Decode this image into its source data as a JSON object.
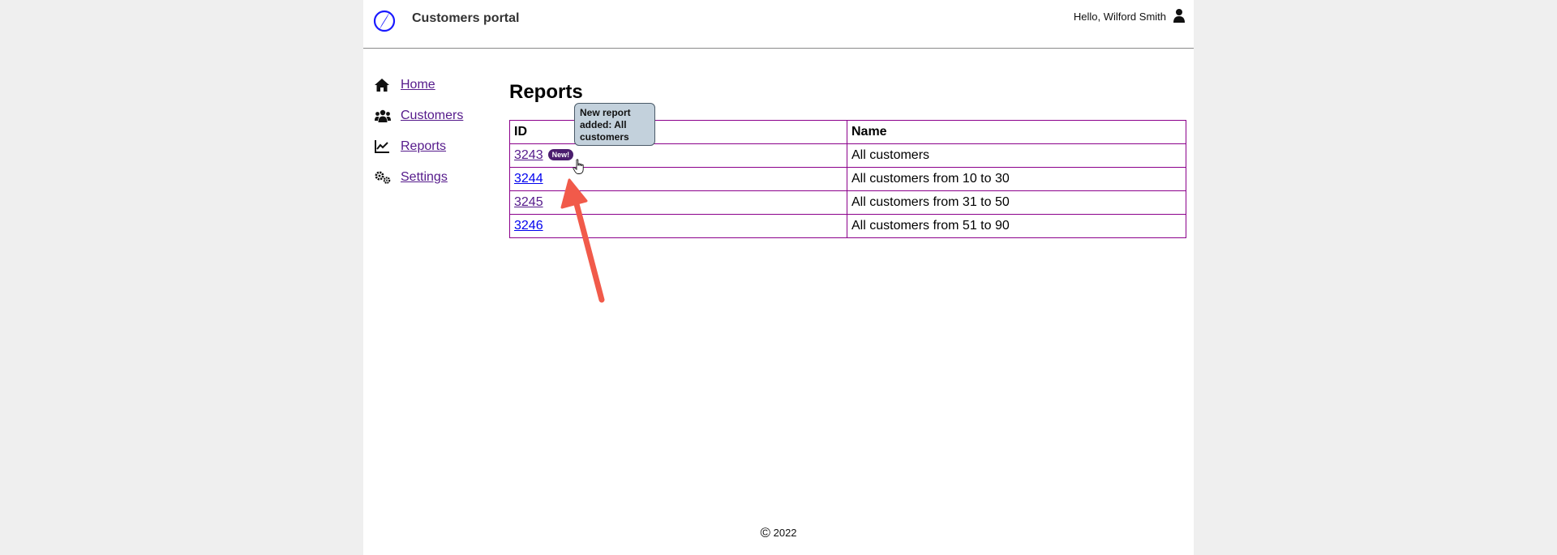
{
  "header": {
    "app_title": "Customers portal",
    "greeting": "Hello, Wilford Smith",
    "logo_icon": "compass-logo-icon",
    "user_icon": "user-icon"
  },
  "sidebar": {
    "items": [
      {
        "label": "Home",
        "icon": "home-icon"
      },
      {
        "label": "Customers",
        "icon": "users-icon"
      },
      {
        "label": "Reports",
        "icon": "chart-line-icon"
      },
      {
        "label": "Settings",
        "icon": "gears-icon"
      }
    ]
  },
  "main": {
    "title": "Reports",
    "columns": [
      "ID",
      "Name"
    ],
    "rows": [
      {
        "id": "3243",
        "name": "All customers",
        "badge": "New!"
      },
      {
        "id": "3244",
        "name": "All customers from 10 to 30"
      },
      {
        "id": "3245",
        "name": "All customers from 31 to 50"
      },
      {
        "id": "3246",
        "name": "All customers from 51 to 90"
      }
    ],
    "tooltip": "New report added: All customers"
  },
  "footer": {
    "copyright_symbol": "©",
    "year": "2022"
  },
  "colors": {
    "link": "#551a8b",
    "table_border": "#8b008b",
    "badge": "#4b1e6e",
    "tooltip_bg": "#c3d1dc",
    "annotation_arrow": "#f15a4a"
  }
}
